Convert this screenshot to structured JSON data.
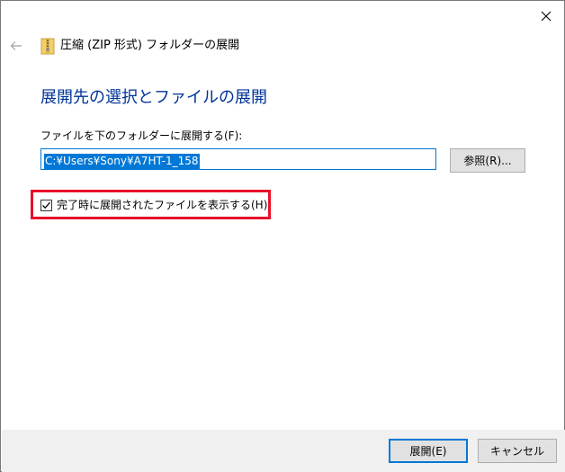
{
  "window": {
    "title": "圧縮 (ZIP 形式) フォルダーの展開"
  },
  "icons": {
    "back": "back-arrow-icon",
    "close": "close-icon",
    "zip_folder": "zip-folder-icon",
    "checkmark": "checkmark-icon"
  },
  "main": {
    "heading": "展開先の選択とファイルの展開",
    "dest_label": "ファイルを下のフォルダーに展開する(F):",
    "path_value": "C:¥Users¥Sony¥A7HT-1_158",
    "browse_label": "参照(R)...",
    "show_files_label": "完了時に展開されたファイルを表示する(H)",
    "show_files_checked": true
  },
  "footer": {
    "extract_label": "展開(E)",
    "cancel_label": "キャンセル"
  },
  "colors": {
    "heading": "#003399",
    "accent": "#0078d7",
    "highlight": "#e8102a",
    "footer_bg": "#f0f0f0"
  }
}
